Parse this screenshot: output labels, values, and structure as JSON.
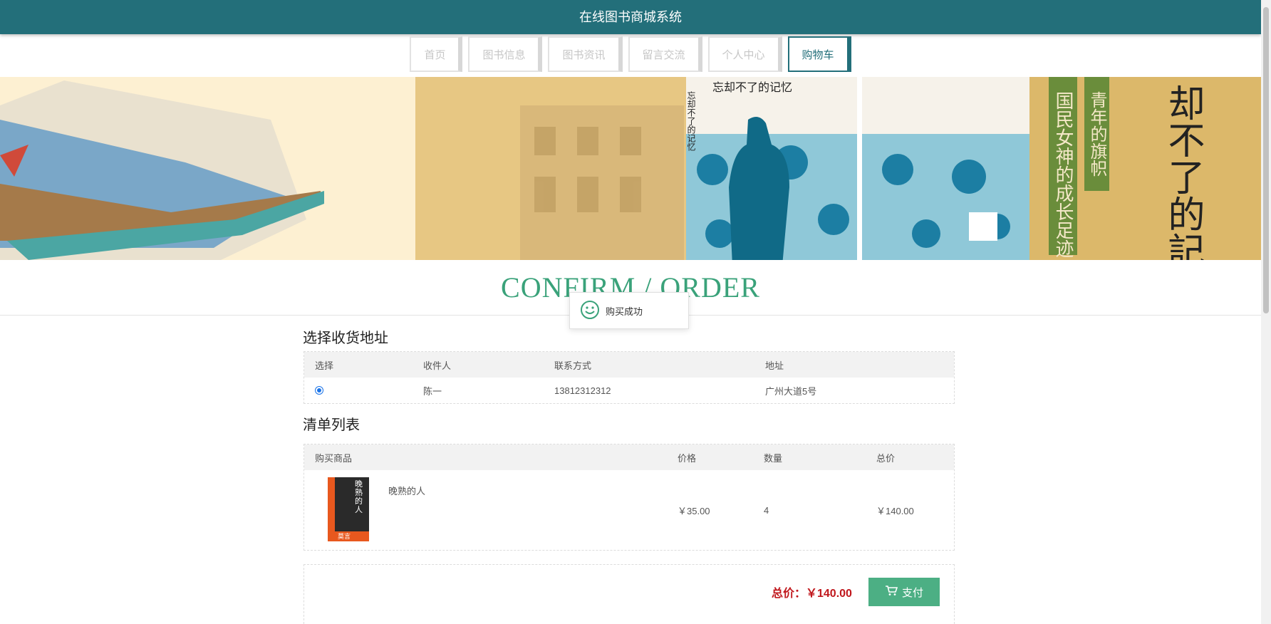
{
  "header": {
    "title": "在线图书商城系统"
  },
  "nav": {
    "items": [
      {
        "label": "首页"
      },
      {
        "label": "图书信息"
      },
      {
        "label": "图书资讯"
      },
      {
        "label": "留言交流"
      },
      {
        "label": "个人中心"
      },
      {
        "label": "购物车"
      }
    ],
    "active_index": 5
  },
  "banner": {
    "left_cover_title": "忘却不了的记忆",
    "spine_text": "忘却不了的记忆",
    "green_strip_line1": "国民女神的成长足迹",
    "green_strip_line2": "青年的旗帜",
    "calligraphy": "却不了的記憶"
  },
  "page": {
    "section_title": "CONFIRM / ORDER"
  },
  "toast": {
    "message": "购买成功"
  },
  "address": {
    "title": "选择收货地址",
    "headers": [
      "选择",
      "收件人",
      "联系方式",
      "地址"
    ],
    "rows": [
      {
        "selected": true,
        "recipient": "陈一",
        "phone": "13812312312",
        "address": "广州大道5号"
      }
    ]
  },
  "order": {
    "title": "清单列表",
    "headers": [
      "购买商品",
      "价格",
      "数量",
      "总价"
    ],
    "items": [
      {
        "name": "晚熟的人",
        "cover_title": "晚熟的人",
        "cover_author": "莫言",
        "price": "￥35.00",
        "quantity": "4",
        "total": "￥140.00"
      }
    ]
  },
  "summary": {
    "total_label": "总价：￥140.00",
    "pay_button": "支付"
  },
  "colors": {
    "header_bg": "#236f7a",
    "accent_green": "#3aa27a",
    "pay_button": "#4caf84",
    "total_red": "#c0171c"
  }
}
